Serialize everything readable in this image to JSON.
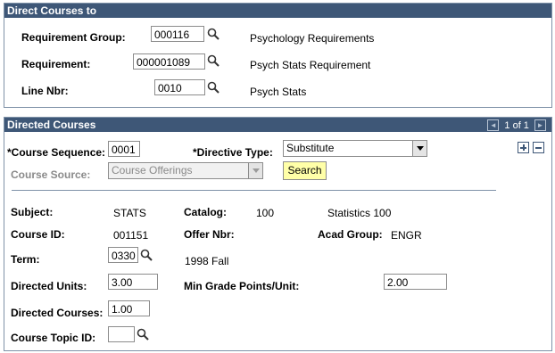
{
  "direct_panel": {
    "title": "Direct Courses to",
    "requirement_group": {
      "label": "Requirement Group:",
      "value": "000116",
      "desc": "Psychology Requirements"
    },
    "requirement": {
      "label": "Requirement:",
      "value": "000001089",
      "desc": "Psych Stats Requirement"
    },
    "line_nbr": {
      "label": "Line Nbr:",
      "value": "0010",
      "desc": "Psych Stats"
    }
  },
  "directed_panel": {
    "title": "Directed Courses",
    "nav": {
      "prev": "◄",
      "count": "1 of 1",
      "next": "►"
    },
    "course_sequence": {
      "req": "*",
      "label": "Course Sequence:",
      "value": "0001"
    },
    "directive_type": {
      "req": "*",
      "label": "Directive Type:",
      "value": "Substitute"
    },
    "course_source": {
      "label": "Course Source:",
      "value": "Course Offerings"
    },
    "search_label": "Search",
    "subject": {
      "label": "Subject:",
      "value": "STATS"
    },
    "catalog": {
      "label": "Catalog:",
      "value": "100",
      "desc": "Statistics 100"
    },
    "course_id": {
      "label": "Course ID:",
      "value": "001151"
    },
    "offer_nbr": {
      "label": "Offer Nbr:"
    },
    "acad_group": {
      "label": "Acad Group:",
      "value": "ENGR"
    },
    "term": {
      "label": "Term:",
      "value": "0330",
      "desc": "1998 Fall"
    },
    "directed_units": {
      "label": "Directed Units:",
      "value": "3.00"
    },
    "min_grade": {
      "label": "Min Grade Points/Unit:",
      "value": "2.00"
    },
    "directed_courses": {
      "label": "Directed Courses:",
      "value": "1.00"
    },
    "course_topic": {
      "label": "Course Topic ID:",
      "value": ""
    }
  },
  "colors": {
    "header": "#3e5777",
    "border": "#7f92a8",
    "button": "#ffffa8"
  },
  "icons": [
    "lookup-icon",
    "add-row-icon",
    "delete-row-icon",
    "first-arrow-icon",
    "last-arrow-icon",
    "dropdown-arrow-icon"
  ]
}
